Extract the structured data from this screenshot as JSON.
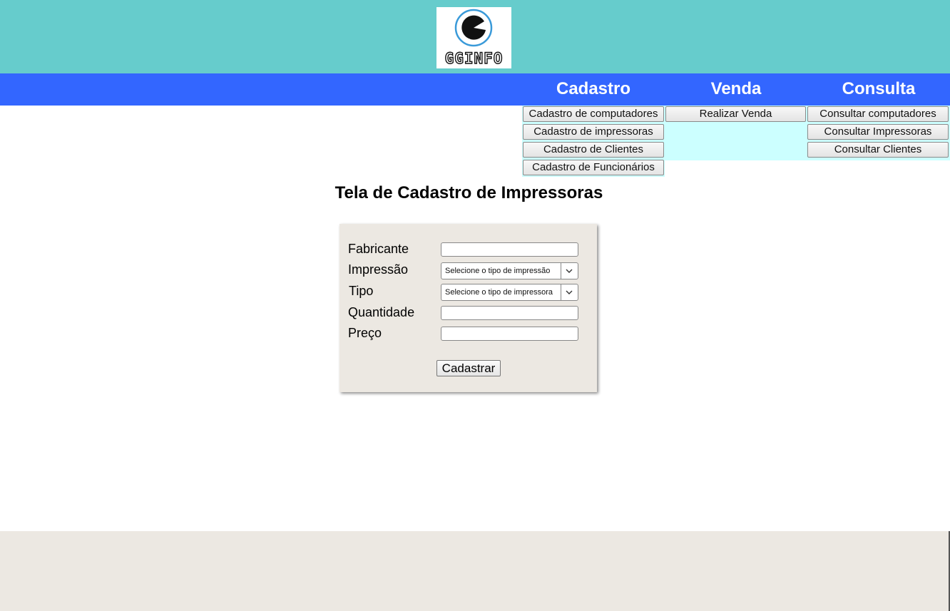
{
  "logo": {
    "text": "GGINFO",
    "icon": "pacman-g-logo-icon"
  },
  "nav": {
    "items": [
      {
        "label": "Cadastro"
      },
      {
        "label": "Venda"
      },
      {
        "label": "Consulta"
      }
    ]
  },
  "submenus": {
    "cadastro": [
      "Cadastro de computadores",
      "Cadastro de impressoras",
      "Cadastro de Clientes",
      "Cadastro de Funcionários"
    ],
    "venda": [
      "Realizar Venda"
    ],
    "consulta": [
      "Consultar computadores",
      "Consultar Impressoras",
      "Consultar Clientes"
    ]
  },
  "page": {
    "title": "Tela de Cadastro de Impressoras"
  },
  "form": {
    "fabricante_label": "Fabricante",
    "fabricante_value": "",
    "impressao_label": "Impressão",
    "impressao_selected": "Selecione o tipo de impressão",
    "tipo_label": "Tipo",
    "tipo_selected": "Selecione o tipo de impressora",
    "quantidade_label": "Quantidade",
    "quantidade_value": "",
    "preco_label": "Preço",
    "preco_value": "",
    "submit_label": "Cadastrar"
  },
  "colors": {
    "header": "#66cccc",
    "navbar": "#3366ff",
    "submenu": "#ccffff",
    "form_bg": "#ece8e2",
    "footer": "#ece8e2"
  }
}
